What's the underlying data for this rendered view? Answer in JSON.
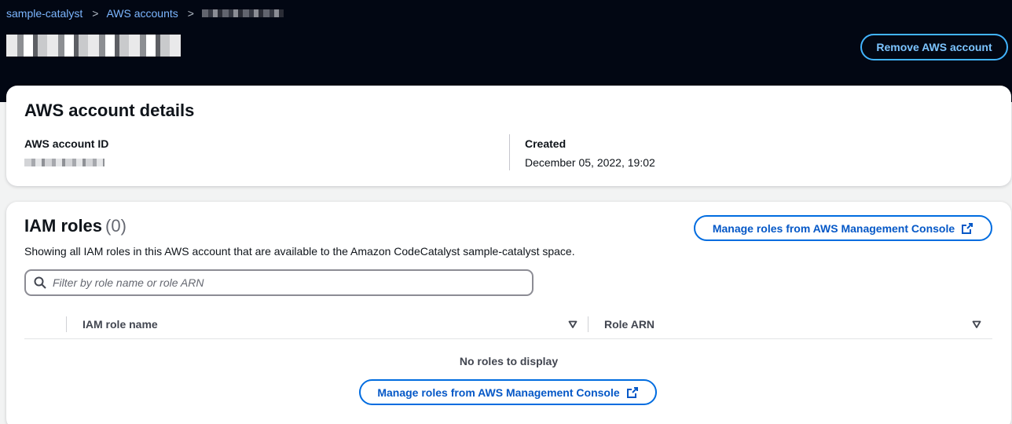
{
  "breadcrumb": {
    "items": [
      "sample-catalyst",
      "AWS accounts"
    ]
  },
  "header": {
    "remove_button_label": "Remove AWS account"
  },
  "details": {
    "title": "AWS account details",
    "account_id_label": "AWS account ID",
    "created_label": "Created",
    "created_value": "December 05, 2022, 19:02"
  },
  "roles": {
    "title": "IAM roles",
    "count": "(0)",
    "description": "Showing all IAM roles in this AWS account that are available to the Amazon CodeCatalyst sample-catalyst space.",
    "manage_button_label": "Manage roles from AWS Management Console",
    "filter_placeholder": "Filter by role name or role ARN",
    "columns": [
      "IAM role name",
      "Role ARN"
    ],
    "empty_message": "No roles to display",
    "empty_button_label": "Manage roles from AWS Management Console"
  },
  "colors": {
    "header_bg": "#020713",
    "accent": "#006ce0",
    "header_button": "#42b4ff"
  },
  "icons": [
    "chevron-right-icon",
    "external-link-icon",
    "search-icon",
    "sort-caret-down-icon"
  ]
}
